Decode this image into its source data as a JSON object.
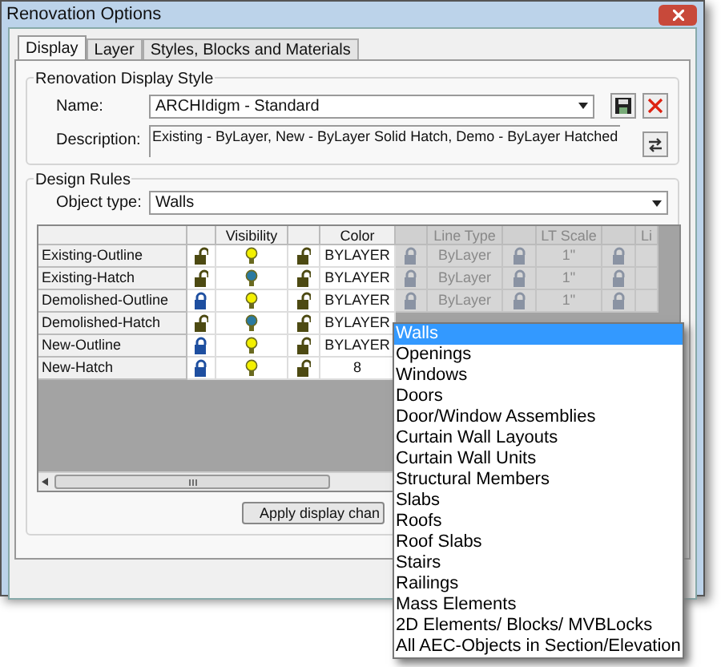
{
  "window": {
    "title": "Renovation Options"
  },
  "tabs": [
    {
      "label": "Display",
      "selected": true
    },
    {
      "label": "Layer",
      "selected": false
    },
    {
      "label": "Styles, Blocks and Materials",
      "selected": false
    }
  ],
  "display_style": {
    "group_title": "Renovation Display Style",
    "name_label": "Name:",
    "name_value": "ARCHIdigm - Standard",
    "description_label": "Description:",
    "description": "Existing - ByLayer, New - ByLayer Solid Hatch, Demo - ByLayer Hatched"
  },
  "design_rules": {
    "group_title": "Design Rules",
    "object_type_label": "Object type:",
    "object_type_value": "Walls",
    "columns": [
      {
        "label": "Visibility",
        "disabled": false
      },
      {
        "label": "Color",
        "disabled": false
      },
      {
        "label": "Line Type",
        "disabled": true
      },
      {
        "label": "LT Scale",
        "disabled": true
      },
      {
        "label": "Li",
        "disabled": true
      }
    ],
    "rows": [
      {
        "name": "Existing-Outline",
        "cells": [
          {
            "locked": false,
            "kind": "bulb",
            "on": true
          },
          {
            "locked": false,
            "kind": "text",
            "value": "BYLAYER"
          },
          {
            "locked": true,
            "kind": "text",
            "value": "ByLayer"
          },
          {
            "locked": true,
            "kind": "text",
            "value": "1\""
          },
          {
            "locked": true,
            "kind": "empty"
          }
        ]
      },
      {
        "name": "Existing-Hatch",
        "cells": [
          {
            "locked": false,
            "kind": "bulb",
            "on": false
          },
          {
            "locked": false,
            "kind": "text",
            "value": "BYLAYER"
          },
          {
            "locked": true,
            "kind": "text",
            "value": "ByLayer"
          },
          {
            "locked": true,
            "kind": "text",
            "value": "1\""
          },
          {
            "locked": true,
            "kind": "empty"
          }
        ]
      },
      {
        "name": "Demolished-Outline",
        "cells": [
          {
            "locked": true,
            "kind": "bulb",
            "on": true
          },
          {
            "locked": false,
            "kind": "text",
            "value": "BYLAYER"
          },
          {
            "locked": true,
            "kind": "text",
            "value": "ByLayer"
          },
          {
            "locked": true,
            "kind": "text",
            "value": "1\""
          },
          {
            "locked": true,
            "kind": "empty"
          }
        ]
      },
      {
        "name": "Demolished-Hatch",
        "cells": [
          {
            "locked": false,
            "kind": "bulb",
            "on": false
          },
          {
            "locked": false,
            "kind": "text",
            "value": "BYLAYER"
          }
        ]
      },
      {
        "name": "New-Outline",
        "cells": [
          {
            "locked": true,
            "kind": "bulb",
            "on": true
          },
          {
            "locked": false,
            "kind": "text",
            "value": "BYLAYER"
          }
        ]
      },
      {
        "name": "New-Hatch",
        "cells": [
          {
            "locked": true,
            "kind": "bulb",
            "on": true
          },
          {
            "locked": false,
            "kind": "text",
            "value": "8"
          }
        ]
      }
    ],
    "apply_button": "Apply display chan"
  },
  "object_type_dropdown": {
    "items": [
      {
        "label": "Walls",
        "selected": true
      },
      {
        "label": "Openings",
        "selected": false
      },
      {
        "label": "Windows",
        "selected": false
      },
      {
        "label": "Doors",
        "selected": false
      },
      {
        "label": "Door/Window Assemblies",
        "selected": false
      },
      {
        "label": "Curtain Wall Layouts",
        "selected": false
      },
      {
        "label": "Curtain Wall Units",
        "selected": false
      },
      {
        "label": "Structural Members",
        "selected": false
      },
      {
        "label": "Slabs",
        "selected": false
      },
      {
        "label": "Roofs",
        "selected": false
      },
      {
        "label": "Roof Slabs",
        "selected": false
      },
      {
        "label": "Stairs",
        "selected": false
      },
      {
        "label": "Railings",
        "selected": false
      },
      {
        "label": "Mass Elements",
        "selected": false
      },
      {
        "label": "2D Elements/ Blocks/ MVBLocks",
        "selected": false
      },
      {
        "label": "All AEC-Objects in Section/Elevation",
        "selected": false
      }
    ]
  }
}
